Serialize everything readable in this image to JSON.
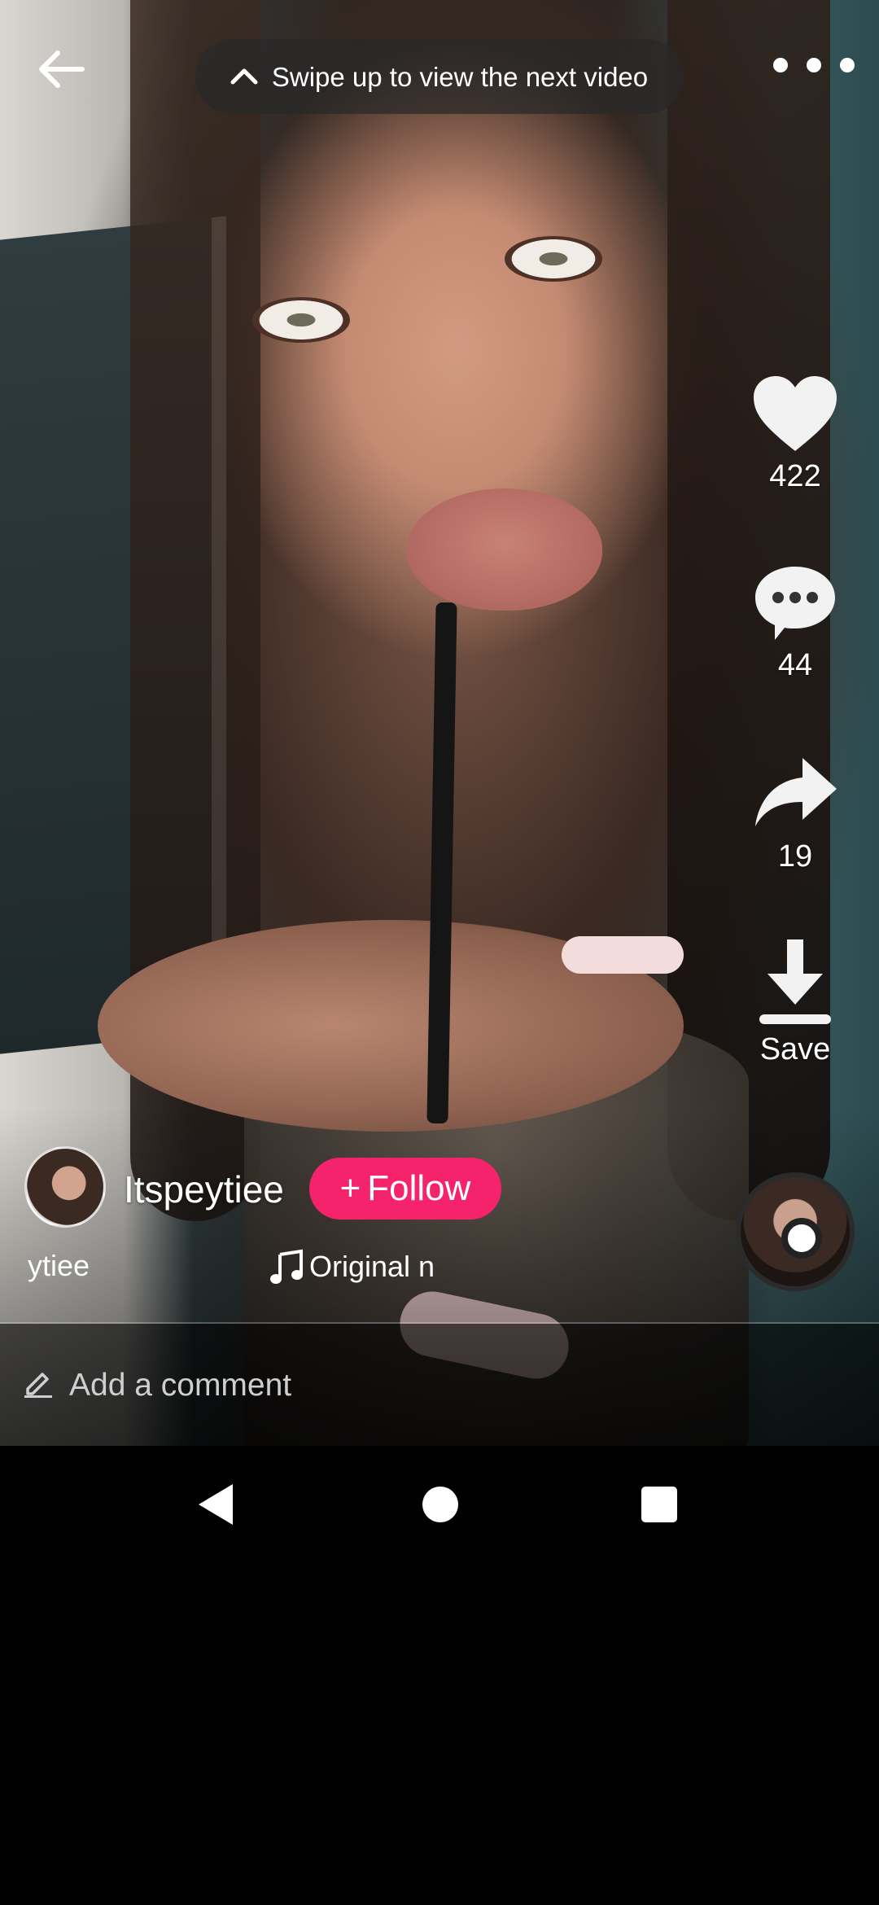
{
  "top_bar": {
    "swipe_hint": "Swipe up to view the next video"
  },
  "actions": {
    "like_count": "422",
    "comment_count": "44",
    "share_count": "19",
    "save_label": "Save"
  },
  "creator": {
    "username": "Itspeytiee",
    "follow_label": "Follow",
    "marquee_fragment": "ytiee",
    "music_text": "Original n"
  },
  "comment_input": {
    "placeholder": "Add a comment"
  },
  "colors": {
    "follow_button": "#f5236b",
    "background": "#000000"
  },
  "icons": {
    "back": "arrow-left-icon",
    "swipe": "chevron-up-icon",
    "more": "more-horizontal-icon",
    "like": "heart-icon",
    "comment": "chat-bubble-icon",
    "share": "share-arrow-icon",
    "save": "download-icon",
    "music": "music-note-icon",
    "pencil": "pencil-icon"
  }
}
